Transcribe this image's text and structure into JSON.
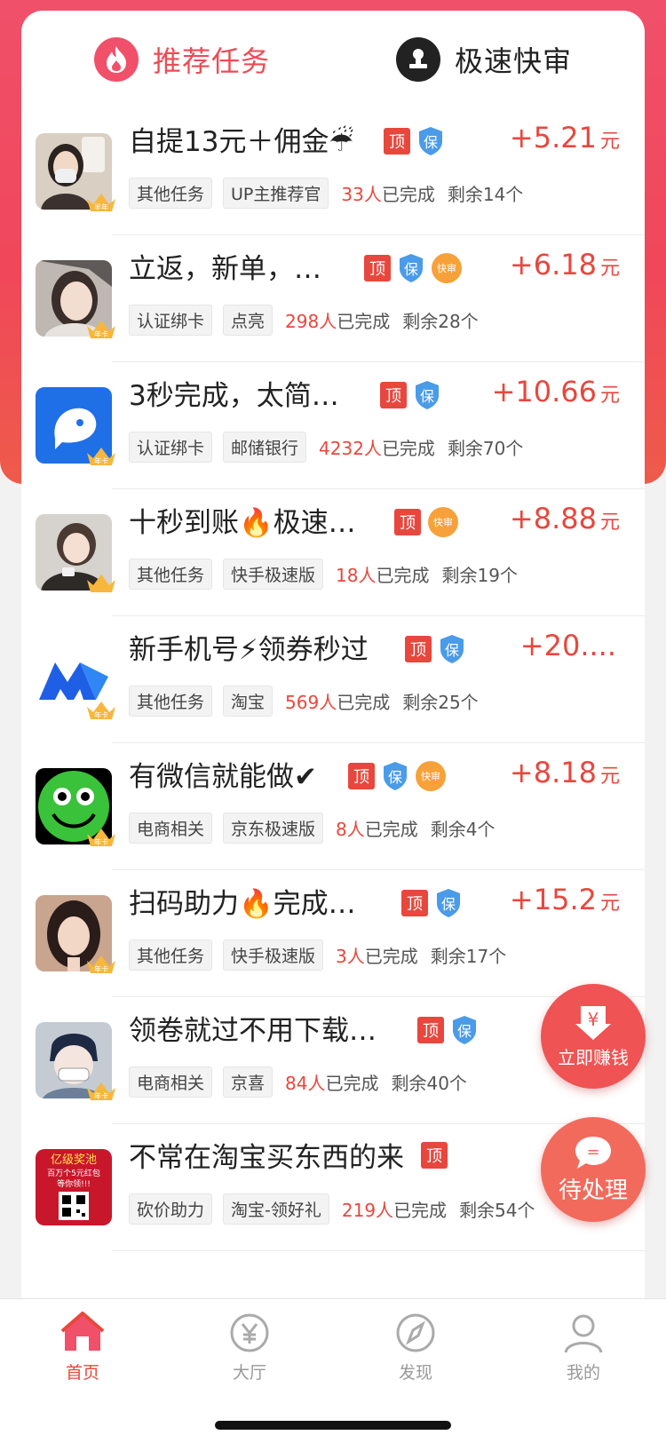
{
  "tabs": {
    "recommend": "推荐任务",
    "fast_review": "极速快审"
  },
  "badges": {
    "top": "顶",
    "bao": "保",
    "kuai": "快审"
  },
  "tasks": [
    {
      "title": "自提13元＋佣金☔",
      "price": "+5.21",
      "unit": "元",
      "tags": [
        "其他任务",
        "UP主推荐官"
      ],
      "done_count": "33人",
      "done_label": "已完成",
      "remain": "剩余14个",
      "avatar_tag": "半年"
    },
    {
      "title": "立返，新单，…",
      "price": "+6.18",
      "unit": "元",
      "tags": [
        "认证绑卡",
        "点亮"
      ],
      "done_count": "298人",
      "done_label": "已完成",
      "remain": "剩余28个",
      "avatar_tag": "年卡"
    },
    {
      "title": "3秒完成，太简…",
      "price": "+10.66",
      "unit": "元",
      "tags": [
        "认证绑卡",
        "邮储银行"
      ],
      "done_count": "4232人",
      "done_label": "已完成",
      "remain": "剩余70个",
      "avatar_tag": "年卡"
    },
    {
      "title": "十秒到账🔥极速…",
      "price": "+8.88",
      "unit": "元",
      "tags": [
        "其他任务",
        "快手极速版"
      ],
      "done_count": "18人",
      "done_label": "已完成",
      "remain": "剩余19个",
      "avatar_tag": ""
    },
    {
      "title": "新手机号⚡领券秒过",
      "price": "+20....",
      "unit": "",
      "tags": [
        "其他任务",
        "淘宝"
      ],
      "done_count": "569人",
      "done_label": "已完成",
      "remain": "剩余25个",
      "avatar_tag": "年卡"
    },
    {
      "title": "有微信就能做✔",
      "price": "+8.18",
      "unit": "元",
      "tags": [
        "电商相关",
        "京东极速版"
      ],
      "done_count": "8人",
      "done_label": "已完成",
      "remain": "剩余4个",
      "avatar_tag": "年卡"
    },
    {
      "title": "扫码助力🔥完成…",
      "price": "+15.2",
      "unit": "元",
      "tags": [
        "其他任务",
        "快手极速版"
      ],
      "done_count": "3人",
      "done_label": "已完成",
      "remain": "剩余17个",
      "avatar_tag": "年卡"
    },
    {
      "title": "领卷就过不用下载…",
      "price": "+",
      "unit": "",
      "tags": [
        "电商相关",
        "京喜"
      ],
      "done_count": "84人",
      "done_label": "已完成",
      "remain": "剩余40个",
      "avatar_tag": "年卡"
    },
    {
      "title": "不常在淘宝买东西的来",
      "price": "+",
      "unit": "",
      "tags": [
        "砍价助力",
        "淘宝-领好礼"
      ],
      "done_count": "219人",
      "done_label": "已完成",
      "remain": "剩余54个",
      "avatar_tag": ""
    }
  ],
  "avatar_text": {
    "banner_line1": "亿级奖池",
    "banner_line2": "百万个5元红包",
    "banner_line3": "等你领!!!"
  },
  "float": {
    "earn_symbol": "¥",
    "earn_label": "立即赚钱",
    "pending_symbol": "=",
    "pending_label": "待处理"
  },
  "tabbar": [
    {
      "label": "首页",
      "icon": "home-icon",
      "active": true
    },
    {
      "label": "大厅",
      "icon": "yuan-coin-icon",
      "active": false
    },
    {
      "label": "发现",
      "icon": "compass-icon",
      "active": false
    },
    {
      "label": "我的",
      "icon": "person-icon",
      "active": false
    }
  ],
  "colors": {
    "accent": "#e8473d",
    "header_red": "#f0506a",
    "bao_blue": "#4a9be8",
    "kuai_orange": "#f7a13a"
  }
}
